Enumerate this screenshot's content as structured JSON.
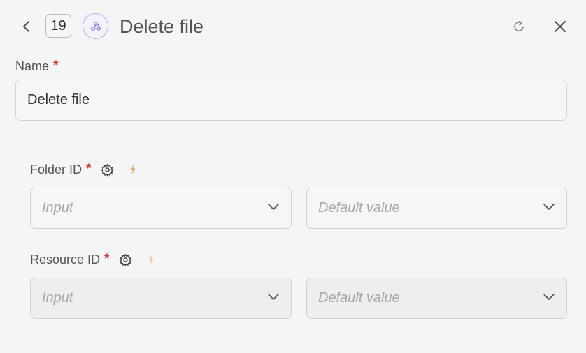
{
  "header": {
    "step_number": "19",
    "title": "Delete file"
  },
  "name_field": {
    "label": "Name",
    "required_mark": "*",
    "value": "Delete file"
  },
  "params": [
    {
      "label": "Folder ID",
      "required_mark": "*",
      "input_placeholder": "Input",
      "default_placeholder": "Default value"
    },
    {
      "label": "Resource ID",
      "required_mark": "*",
      "input_placeholder": "Input",
      "default_placeholder": "Default value"
    }
  ],
  "icons": {
    "back": "chevron-left-icon",
    "node": "webhook-icon",
    "refresh": "refresh-icon",
    "close": "close-icon",
    "settings": "gear-icon",
    "dynamic": "lightning-icon",
    "dropdown": "chevron-down-icon"
  },
  "colors": {
    "background": "#f5f5f5",
    "required": "#dc3c3c",
    "node_accent": "#8d7fe8",
    "bolt": "#f0a060"
  }
}
